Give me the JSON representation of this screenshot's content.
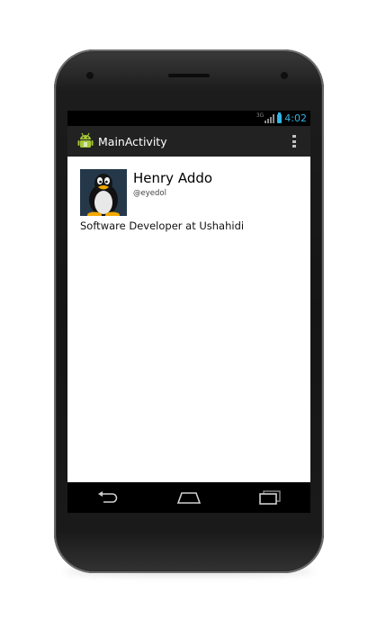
{
  "status_bar": {
    "network_type": "3G",
    "time": "4:02"
  },
  "action_bar": {
    "title": "MainActivity",
    "app_icon": "android-icon",
    "overflow_icon": "overflow-menu-icon"
  },
  "profile": {
    "name": "Henry Addo",
    "handle": "@eyedol",
    "bio": "Software Developer at Ushahidi",
    "avatar_icon": "tux-penguin-avatar"
  },
  "navigation_bar": {
    "back_icon": "back-icon",
    "home_icon": "home-icon",
    "recents_icon": "recents-icon"
  },
  "colors": {
    "accent": "#33b5e5",
    "action_bar_bg": "#222222",
    "content_bg": "#ffffff"
  }
}
